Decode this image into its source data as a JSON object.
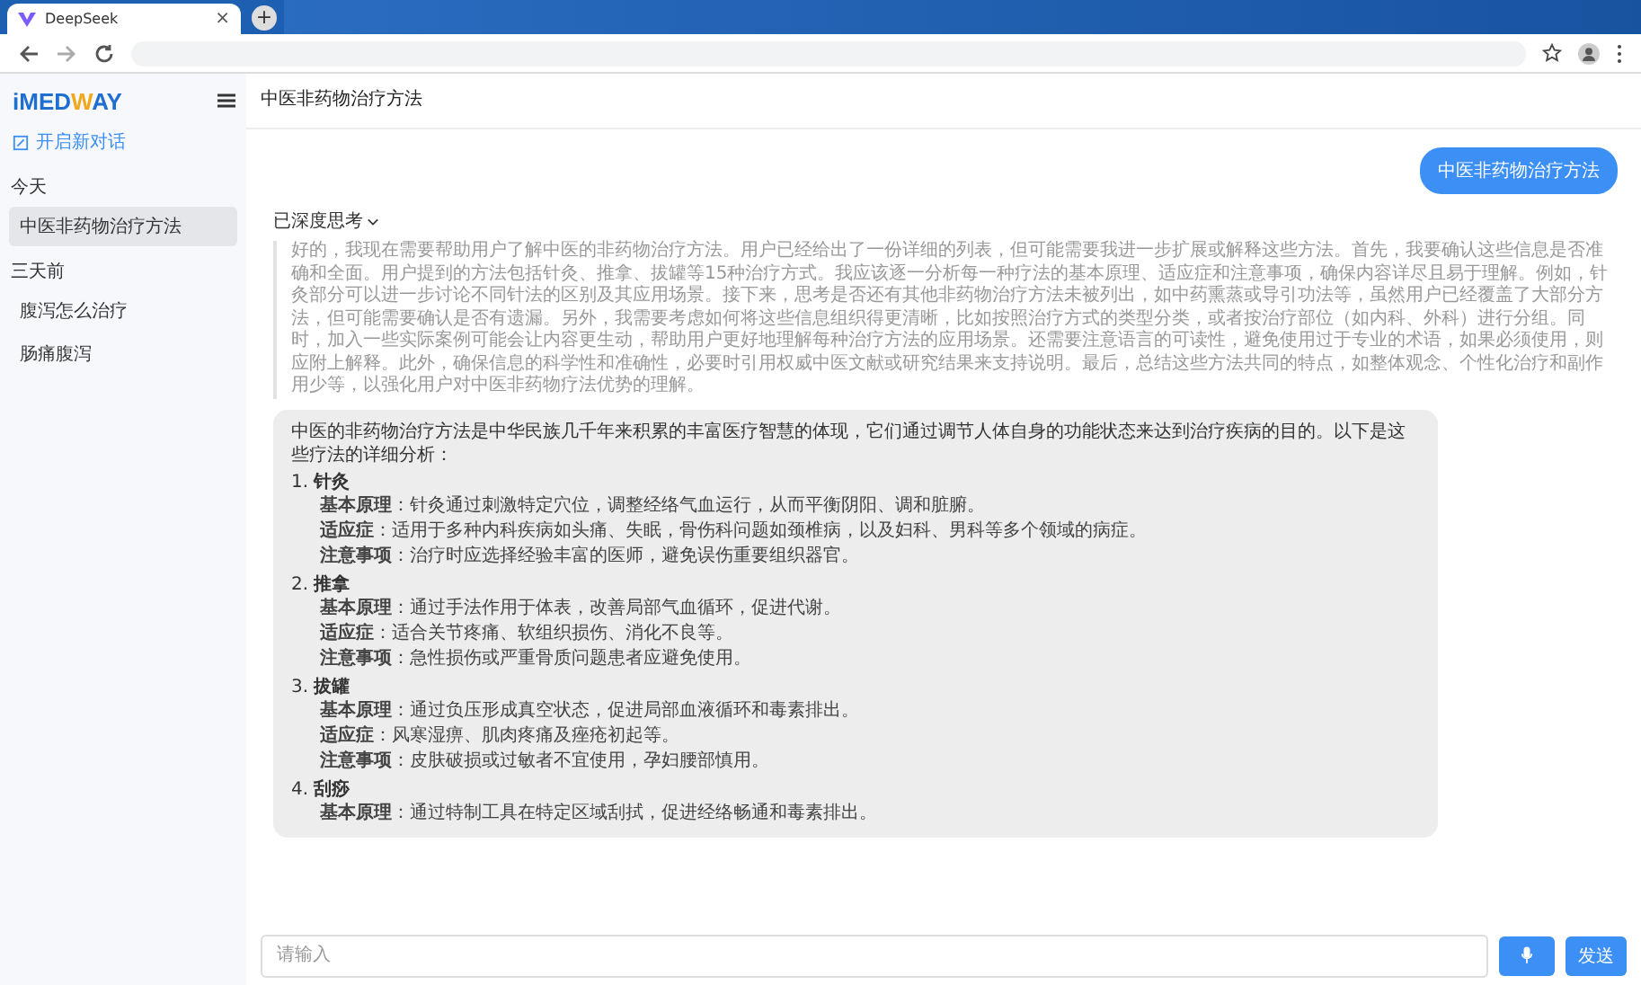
{
  "browser": {
    "tab": {
      "title": "DeepSeek",
      "close": "×"
    },
    "new_tab": "+"
  },
  "sidebar": {
    "logo": [
      "iMED",
      "W",
      "AY"
    ],
    "new_chat": "开启新对话",
    "groups": [
      {
        "label": "今天",
        "items": [
          {
            "title": "中医非药物治疗方法",
            "selected": true
          }
        ]
      },
      {
        "label": "三天前",
        "items": [
          {
            "title": "腹泻怎么治疗",
            "selected": false
          },
          {
            "title": "肠痛腹泻",
            "selected": false
          }
        ]
      }
    ]
  },
  "chat": {
    "title": "中医非药物治疗方法",
    "user_message": "中医非药物治疗方法",
    "thinking_toggle": "已深度思考",
    "thinking": "好的，我现在需要帮助用户了解中医的非药物治疗方法。用户已经给出了一份详细的列表，但可能需要我进一步扩展或解释这些方法。首先，我要确认这些信息是否准确和全面。用户提到的方法包括针灸、推拿、拔罐等15种治疗方式。我应该逐一分析每一种疗法的基本原理、适应症和注意事项，确保内容详尽且易于理解。例如，针灸部分可以进一步讨论不同针法的区别及其应用场景。接下来，思考是否还有其他非药物治疗方法未被列出，如中药熏蒸或导引功法等，虽然用户已经覆盖了大部分方法，但可能需要确认是否有遗漏。另外，我需要考虑如何将这些信息组织得更清晰，比如按照治疗方式的类型分类，或者按治疗部位（如内科、外科）进行分组。同时，加入一些实际案例可能会让内容更生动，帮助用户更好地理解每种治疗方法的应用场景。还需要注意语言的可读性，避免使用过于专业的术语，如果必须使用，则应附上解释。此外，确保信息的科学性和准确性，必要时引用权威中医文献或研究结果来支持说明。最后，总结这些方法共同的特点，如整体观念、个性化治疗和副作用少等，以强化用户对中医非药物疗法优势的理解。",
    "answer_intro": "中医的非药物治疗方法是中华民族几千年来积累的丰富医疗智慧的体现，它们通过调节人体自身的功能状态来达到治疗疾病的目的。以下是这些疗法的详细分析：",
    "sections": [
      {
        "title": "1. **针灸**",
        "items": [
          "**基本原理**：针灸通过刺激特定穴位，调整经络气血运行，从而平衡阴阳、调和脏腑。",
          "**适应症**：适用于多种内科疾病如头痛、失眠，骨伤科问题如颈椎病，以及妇科、男科等多个领域的病症。",
          "**注意事项**：治疗时应选择经验丰富的医师，避免误伤重要组织器官。"
        ]
      },
      {
        "title": "2. **推拿**",
        "items": [
          "**基本原理**：通过手法作用于体表，改善局部气血循环，促进代谢。",
          "**适应症**：适合关节疼痛、软组织损伤、消化不良等。",
          "**注意事项**：急性损伤或严重骨质问题患者应避免使用。"
        ]
      },
      {
        "title": "3. **拔罐**",
        "items": [
          "**基本原理**：通过负压形成真空状态，促进局部血液循环和毒素排出。",
          "**适应症**：风寒湿痹、肌肉疼痛及痤疮初起等。",
          "**注意事项**：皮肤破损或过敏者不宜使用，孕妇腰部慎用。"
        ]
      },
      {
        "title": "4. **刮痧**",
        "items": [
          "**基本原理**：通过特制工具在特定区域刮拭，促进经络畅通和毒素排出。"
        ]
      }
    ]
  },
  "composer": {
    "placeholder": "请输入",
    "send": "发送"
  }
}
